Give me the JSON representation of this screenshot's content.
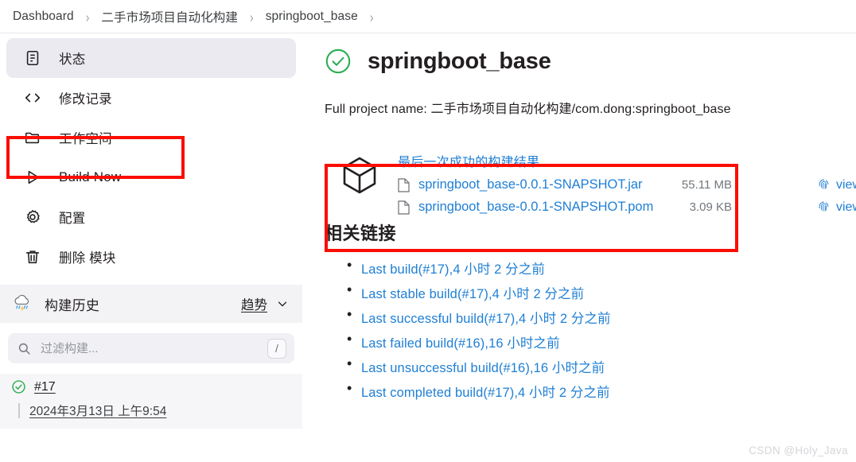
{
  "breadcrumb": {
    "items": [
      {
        "label": "Dashboard"
      },
      {
        "label": "二手市场项目自动化构建"
      },
      {
        "label": "springboot_base"
      }
    ],
    "separator": "›"
  },
  "sidebar": {
    "items": [
      {
        "label": "状态",
        "icon": "document-icon",
        "active": true
      },
      {
        "label": "修改记录",
        "icon": "code-icon",
        "active": false
      },
      {
        "label": "工作空间",
        "icon": "folder-icon",
        "active": false,
        "highlighted": true
      },
      {
        "label": "Build Now",
        "icon": "play-icon",
        "active": false
      },
      {
        "label": "配置",
        "icon": "gear-icon",
        "active": false
      },
      {
        "label": "删除 模块",
        "icon": "trash-icon",
        "active": false
      }
    ],
    "build_history": {
      "title": "构建历史",
      "weather_icon": "cloud-rain-icon",
      "trend_label": "趋势",
      "chevron_icon": "chevron-down-icon",
      "filter": {
        "placeholder": "过滤构建...",
        "value": "",
        "search_icon": "search-icon",
        "shortcut": "/"
      },
      "builds": [
        {
          "number": "#17",
          "status_icon": "check-circle-icon",
          "date": "2024年3月13日 上午9:54"
        }
      ]
    }
  },
  "main": {
    "status_icon": "check-circle-icon",
    "title": "springboot_base",
    "full_project_name": "Full project name: 二手市场项目自动化构建/com.dong:springboot_base",
    "artifacts": {
      "package_icon": "cube-icon",
      "heading": "最后一次成功的构建结果",
      "files": [
        {
          "icon": "file-icon",
          "name": "springboot_base-0.0.1-SNAPSHOT.jar",
          "size": "55.11 MB",
          "view_label": "view",
          "view_icon": "fingerprint-icon"
        },
        {
          "icon": "file-icon",
          "name": "springboot_base-0.0.1-SNAPSHOT.pom",
          "size": "3.09 KB",
          "view_label": "view",
          "view_icon": "fingerprint-icon"
        }
      ]
    },
    "related_links": {
      "title": "相关链接",
      "links": [
        {
          "label": "Last build(#17),4 小时 2 分之前"
        },
        {
          "label": "Last stable build(#17),4 小时 2 分之前"
        },
        {
          "label": "Last successful build(#17),4 小时 2 分之前"
        },
        {
          "label": "Last failed build(#16),16 小时之前"
        },
        {
          "label": "Last unsuccessful build(#16),16 小时之前"
        },
        {
          "label": "Last completed build(#17),4 小时 2 分之前"
        }
      ]
    }
  },
  "watermark": {
    "text": "CSDN @Holy_Java"
  },
  "colors": {
    "link": "#1f7fd4",
    "success": "#2bae52",
    "annotation": "#fb0d00",
    "active_bg": "#eaeaf0"
  }
}
